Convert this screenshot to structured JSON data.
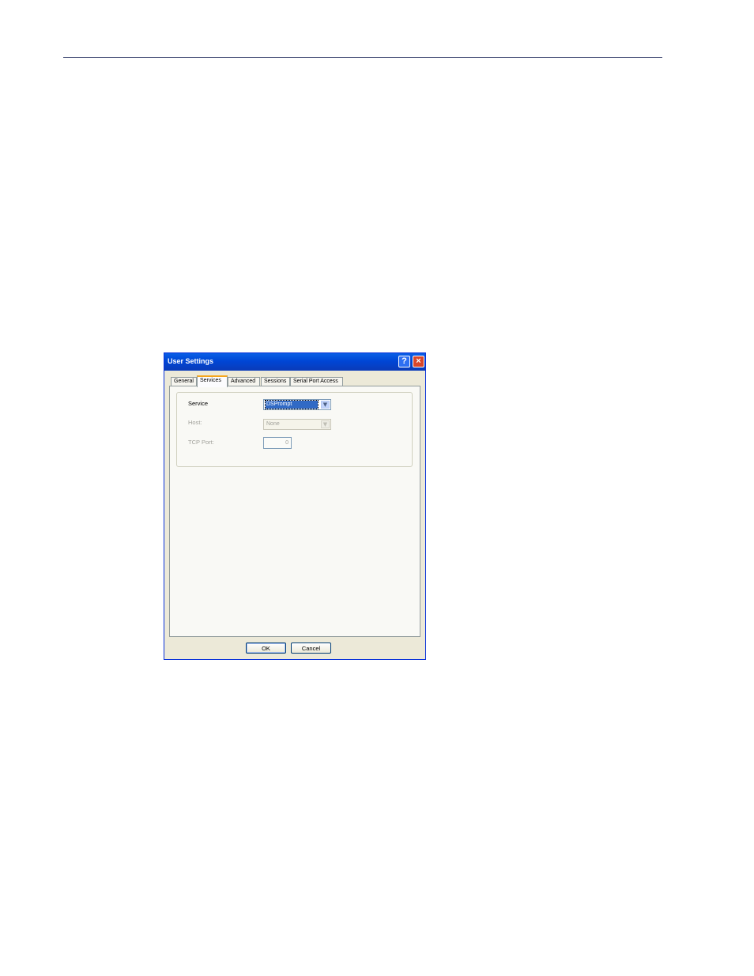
{
  "dialog": {
    "title": "User Settings",
    "help_glyph": "?",
    "close_glyph": "×"
  },
  "tabs": [
    {
      "label": "General",
      "active": false
    },
    {
      "label": "Services",
      "active": true
    },
    {
      "label": "Advanced",
      "active": false
    },
    {
      "label": "Sessions",
      "active": false
    },
    {
      "label": "Serial Port Access",
      "active": false
    }
  ],
  "services": {
    "service_label": "Service",
    "service_value": "DSPrompt",
    "host_label": "Host:",
    "host_value": "None",
    "tcp_port_label": "TCP Port:",
    "tcp_port_value": "0"
  },
  "buttons": {
    "ok": "OK",
    "cancel": "Cancel"
  },
  "colors": {
    "title_bar": "#0046d5",
    "selection": "#316ac5",
    "active_tab_accent": "#f5a61c"
  },
  "icons": {
    "dropdown": "chevron-down-icon",
    "help": "help-icon",
    "close": "close-icon"
  }
}
